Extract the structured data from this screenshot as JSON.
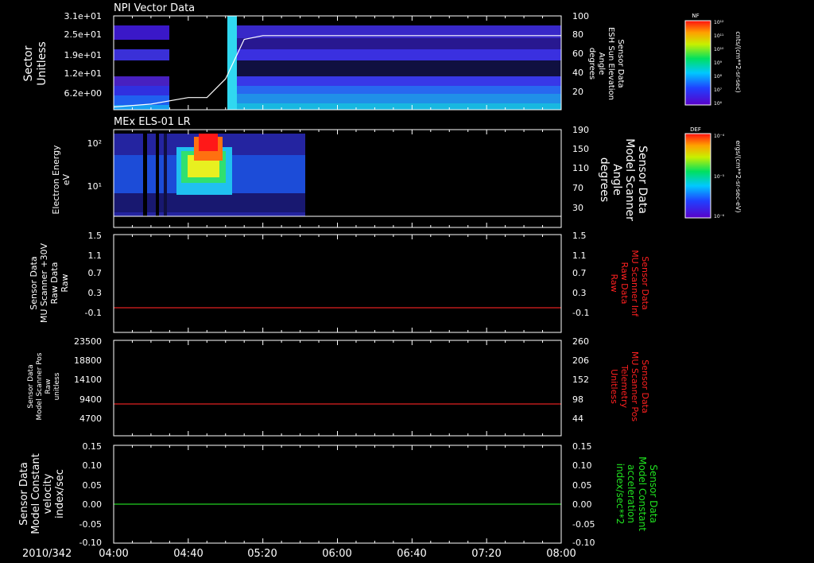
{
  "colors": {
    "background": "#000000",
    "foreground": "#ffffff",
    "red_trace": "#e02020",
    "green_trace": "#20d020",
    "right_label_red": "#ff2020",
    "right_label_green": "#20e020"
  },
  "time_axis": {
    "ticks": [
      "04:00",
      "04:40",
      "05:20",
      "06:00",
      "06:40",
      "07:20",
      "08:00"
    ],
    "date_label": "2010/342"
  },
  "panels": [
    {
      "id": "npi",
      "title": "NPI Vector Data",
      "left_label": [
        "Sector",
        "Unitless"
      ],
      "left_ticks": [
        "3.1e+01",
        "2.5e+01",
        "1.9e+01",
        "1.2e+01",
        "6.2e+00"
      ],
      "right_label": [
        "Sensor Data",
        "ESH Sun Elevation",
        "Angle",
        "degrees"
      ],
      "right_ticks": [
        "100",
        "80",
        "60",
        "40",
        "20"
      ],
      "colorbar": {
        "name": "NF",
        "units": "cnts/(cm**2-sr-sec)",
        "ticks": [
          "10¹²",
          "10¹¹",
          "10¹⁰",
          "10⁹",
          "10⁸",
          "10⁷",
          "10⁶"
        ]
      }
    },
    {
      "id": "els",
      "title": "MEx ELS-01 LR",
      "left_label": [
        "Electron Energy",
        "eV"
      ],
      "left_ticks": [
        "10²",
        "10¹"
      ],
      "right_label": [
        "Sensor Data",
        "Model Scanner",
        "Angle",
        "degrees"
      ],
      "right_ticks": [
        "190",
        "150",
        "110",
        "70",
        "30"
      ],
      "colorbar": {
        "name": "DEF",
        "units": "ergs/(cm**2-sr-sec-eV)",
        "ticks": [
          "10⁻⁴",
          "10⁻⁵",
          "10⁻⁶"
        ]
      }
    },
    {
      "id": "mu_raw",
      "left_label": [
        "Sensor Data",
        "MU Scanner +30V",
        "Raw Data",
        "Raw"
      ],
      "left_ticks": [
        "1.5",
        "1.1",
        "0.7",
        "0.3",
        "-0.1"
      ],
      "right_label": [
        "Sensor Data",
        "MU Scanner Inf",
        "Raw Data",
        "Raw"
      ],
      "right_ticks": [
        "1.5",
        "1.1",
        "0.7",
        "0.3",
        "-0.1"
      ]
    },
    {
      "id": "mu_pos",
      "left_label": [
        "Sensor Data",
        "Model Scanner Pos",
        "Raw",
        "unitless"
      ],
      "left_ticks": [
        "23500",
        "18800",
        "14100",
        "9400",
        "4700"
      ],
      "right_label": [
        "Sensor Data",
        "MU Scanner Pos",
        "Telemetry",
        "Unitless"
      ],
      "right_ticks": [
        "260",
        "206",
        "152",
        "98",
        "44"
      ]
    },
    {
      "id": "model_const",
      "left_label": [
        "Sensor Data",
        "Model Constant",
        "velocity",
        "index/sec"
      ],
      "left_ticks": [
        "0.15",
        "0.10",
        "0.05",
        "0.00",
        "-0.05",
        "-0.10"
      ],
      "right_label": [
        "Sensor Data",
        "Model Constant",
        "acceleration",
        "index/sec**2"
      ],
      "right_ticks": [
        "0.15",
        "0.10",
        "0.05",
        "0.00",
        "-0.05",
        "-0.10"
      ]
    }
  ],
  "chart_data": [
    {
      "type": "heatmap",
      "title": "NPI Vector Data",
      "x_range": [
        "04:00",
        "08:00"
      ],
      "ylabel": "Sector Unitless",
      "y_ticks": [
        31,
        25,
        19,
        12,
        6.2
      ],
      "overlay_line": {
        "name": "ESH Sun Elevation Angle",
        "ylim": [
          0,
          100
        ],
        "x": [
          "04:00",
          "04:20",
          "04:40",
          "04:50",
          "05:00",
          "05:10",
          "05:20",
          "06:00",
          "08:00"
        ],
        "y": [
          3,
          6,
          13,
          13,
          33,
          75,
          79,
          79,
          79
        ]
      }
    },
    {
      "type": "heatmap",
      "title": "MEx ELS-01 LR",
      "x_range": [
        "04:00",
        "08:00"
      ],
      "ylabel": "Electron Energy eV",
      "y_scale": "log",
      "data_end_time": "05:38"
    },
    {
      "type": "line",
      "x_range": [
        "04:00",
        "08:00"
      ],
      "ylim": [
        -0.3,
        1.5
      ],
      "series": [
        {
          "name": "MU Scanner +30V Raw Data",
          "x": [
            "04:00",
            "08:00"
          ],
          "y": [
            -0.1,
            -0.1
          ]
        }
      ]
    },
    {
      "type": "line",
      "x_range": [
        "04:00",
        "08:00"
      ],
      "ylim": [
        0,
        23500
      ],
      "series": [
        {
          "name": "Model Scanner Pos Raw",
          "x": [
            "04:00",
            "08:00"
          ],
          "y": [
            8200,
            8200
          ]
        }
      ]
    },
    {
      "type": "line",
      "x_range": [
        "04:00",
        "08:00"
      ],
      "ylim": [
        -0.1,
        0.15
      ],
      "series": [
        {
          "name": "Model Constant velocity",
          "x": [
            "04:00",
            "08:00"
          ],
          "y": [
            0.0,
            0.0
          ]
        }
      ]
    }
  ]
}
